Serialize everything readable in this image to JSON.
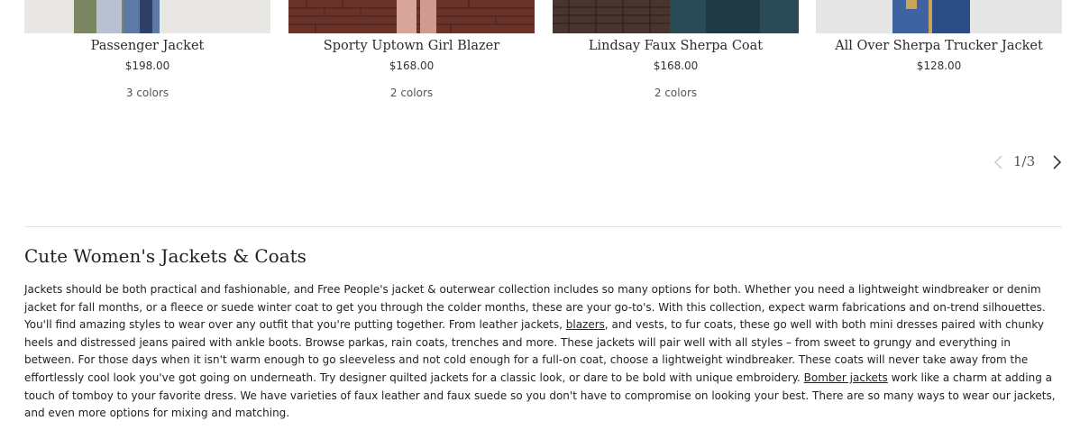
{
  "products": [
    {
      "name": "Passenger Jacket",
      "price": "$198.00",
      "colors": "3 colors",
      "image_colors": [
        "#e9e7e3",
        "#7a8664",
        "#5d79a8",
        "#2f3f66"
      ]
    },
    {
      "name": "Sporty Uptown Girl Blazer",
      "price": "$168.00",
      "colors": "2 colors",
      "image_colors": [
        "#7a3a2f",
        "#5a2b25",
        "#d8a59b",
        "#3c2220"
      ]
    },
    {
      "name": "Lindsay Faux Sherpa Coat",
      "price": "$168.00",
      "colors": "2 colors",
      "image_colors": [
        "#5a3a33",
        "#3f2c2a",
        "#2a4a55",
        "#7b6a5e"
      ]
    },
    {
      "name": "All Over Sherpa Trucker Jacket",
      "price": "$128.00",
      "colors": "",
      "image_colors": [
        "#e6e6e6",
        "#3f63a0",
        "#2a4d86",
        "#c9a45a"
      ]
    }
  ],
  "pager": {
    "current": "1",
    "separator": "/",
    "total": "3"
  },
  "seo": {
    "title": "Cute Women's Jackets & Coats",
    "p1": "Jackets should be both practical and fashionable, and Free People's jacket & outerwear collection includes so many options for both. Whether you need a lightweight windbreaker or denim jacket for fall months, or a fleece or suede winter coat to get you through the colder months, these are your go-to's. With this collection, expect warm fabrications and on-trend silhouettes. You'll find amazing styles to wear over any outfit that you're putting together. From leather jackets, ",
    "link1": "blazers",
    "p2": ", and vests, to fur coats, these go well with both mini dresses paired with chunky heels and distressed jeans paired with ankle boots. Browse parkas, rain coats, trenches and more. These jackets will pair well with all styles – from sweet to grungy and everything in between. For those days when it isn't warm enough to go sleeveless and not cold enough for a full-on coat, choose a lightweight windbreaker. These coats will never take away from the effortlessly cool look you've got going on underneath. Try designer quilted jackets for a classic look, or dare to be bold with unique embroidery. ",
    "link2": "Bomber jackets",
    "p3": " work like a charm at adding a touch of tomboy to your favorite dress. We have varieties of faux leather and faux suede so you don't have to compromise on looking your best. There are so many ways to wear our jackets, and even more options for mixing and matching."
  },
  "colors": {
    "divider": "#e3e3e3",
    "text": "#222222",
    "muted": "#555555"
  }
}
